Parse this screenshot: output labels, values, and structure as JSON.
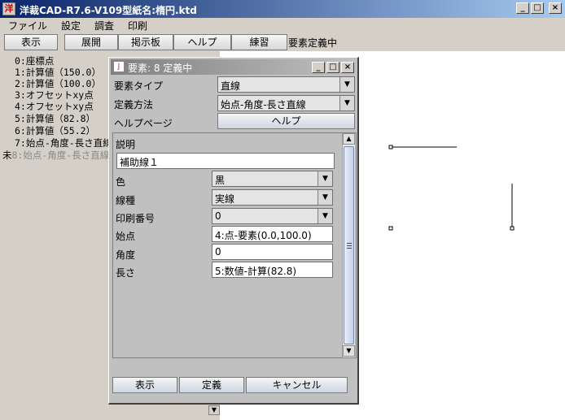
{
  "window": {
    "title": "洋裁CAD-R7.6-V109型紙名:楕円.ktd",
    "icon_text": "洋",
    "controls": {
      "minimize": "_",
      "maximize": "□",
      "close": "×"
    }
  },
  "menu": [
    "ファイル",
    "設定",
    "調査",
    "印刷"
  ],
  "toolbar": {
    "buttons": [
      "表示",
      "展開",
      "掲示板",
      "ヘルプ",
      "練習"
    ],
    "status": "要素定義中"
  },
  "element_list": {
    "items": [
      "0:座標点",
      "1:計算値（150.0）",
      "2:計算値（100.0）",
      "3:オフセットxy点",
      "4:オフセットxy点",
      "5:計算値（82.8）",
      "6:計算値（55.2）",
      "7:始点-角度-長さ直線"
    ],
    "pending_mark": "未",
    "pending_item": "8:始点-角度-長さ直線"
  },
  "dialog": {
    "title": "要素: 8 定義中",
    "icon_text": "J",
    "element_type_label": "要素タイプ",
    "element_type_value": "直線",
    "method_label": "定義方法",
    "method_value": "始点-角度-長さ直線",
    "help_page_label": "ヘルプページ",
    "help_button": "ヘルプ",
    "description_label": "説明",
    "description_value": "補助線１",
    "color_label": "色",
    "color_value": "黒",
    "linetype_label": "線種",
    "linetype_value": "実線",
    "print_no_label": "印刷番号",
    "print_no_value": "0",
    "start_label": "始点",
    "start_value": "4:点-要素(0.0,100.0)",
    "angle_label": "角度",
    "angle_value": "0",
    "length_label": "長さ",
    "length_value": "5:数値-計算(82.8)",
    "buttons": {
      "show": "表示",
      "define": "定義",
      "cancel": "キャンセル"
    }
  },
  "colors": {
    "title_bar": "#0a246a",
    "dialog_title": "#808080",
    "canvas": "#ffffff",
    "face": "#d4d0c8"
  }
}
